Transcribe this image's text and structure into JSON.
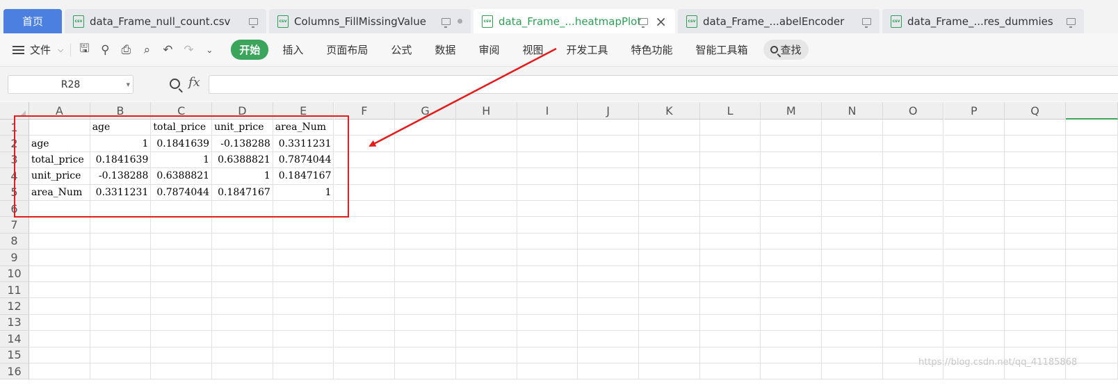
{
  "tabs": {
    "home": "首页",
    "files": [
      {
        "label": "data_Frame_null_count.csv",
        "active": false,
        "marker": "monitor"
      },
      {
        "label": "Columns_FillMissingValue",
        "active": false,
        "marker": "monitor-dot"
      },
      {
        "label": "data_Frame_...heatmapPlot",
        "active": true,
        "marker": "monitor-close"
      },
      {
        "label": "data_Frame_...abelEncoder",
        "active": false,
        "marker": "monitor"
      },
      {
        "label": "data_Frame_...res_dummies",
        "active": false,
        "marker": "monitor"
      }
    ],
    "file_icon_text": "csv"
  },
  "toolbar": {
    "menu_label": "文件",
    "quick_icons": [
      "save-icon",
      "format-painter-icon",
      "print-icon",
      "print-preview-icon",
      "undo-icon",
      "redo-icon",
      "more-icon"
    ],
    "ribbon_tabs": [
      "开始",
      "插入",
      "页面布局",
      "公式",
      "数据",
      "审阅",
      "视图",
      "开发工具",
      "特色功能",
      "智能工具箱"
    ],
    "search_label": "查找"
  },
  "formula_bar": {
    "cell_ref": "R28",
    "fx_label": "fx",
    "content": ""
  },
  "sheet": {
    "columns": [
      "A",
      "B",
      "C",
      "D",
      "E",
      "F",
      "G",
      "H",
      "I",
      "J",
      "K",
      "L",
      "M",
      "N",
      "O",
      "P",
      "Q"
    ],
    "row_numbers": [
      "1",
      "2",
      "3",
      "4",
      "5",
      "6",
      "7",
      "8",
      "9",
      "10",
      "11",
      "12",
      "13",
      "14",
      "15",
      "16"
    ],
    "cells": [
      [
        "",
        "age",
        "total_price",
        "unit_price",
        "area_Num"
      ],
      [
        "age",
        "1",
        "0.1841639",
        "-0.138288",
        "0.3311231"
      ],
      [
        "total_price",
        "0.1841639",
        "1",
        "0.6388821",
        "0.7874044"
      ],
      [
        "unit_price",
        "-0.138288",
        "0.6388821",
        "1",
        "0.1847167"
      ],
      [
        "area_Num",
        "0.3311231",
        "0.7874044",
        "0.1847167",
        "1"
      ]
    ]
  },
  "annotation_color": "#e31b1b",
  "accent_green": "#3ba55c",
  "home_blue": "#4b7fe0",
  "watermark": "https://blog.csdn.net/qq_41185868"
}
